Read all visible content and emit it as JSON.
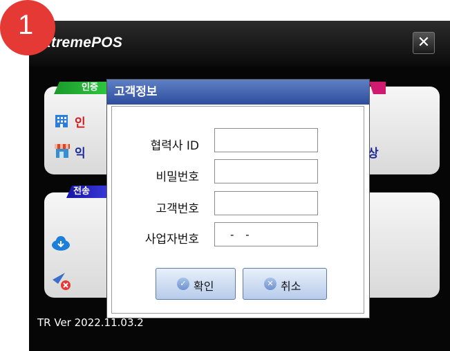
{
  "badge": "1",
  "app": {
    "logo_dots": "••",
    "logo_text": "xtremePOS",
    "close_icon": "✕",
    "version": "TR Ver 2022.11.03.2"
  },
  "panels": {
    "auth_tag": "인증",
    "transfer_tag": "전송",
    "row1_text": "인",
    "row2_text": "익",
    "row2_suffix": "상"
  },
  "dialog": {
    "title": "고객정보",
    "fields": [
      {
        "label": "협력사 ID",
        "value": ""
      },
      {
        "label": "비밀번호",
        "value": ""
      },
      {
        "label": "고객번호",
        "value": ""
      },
      {
        "label": "사업자번호",
        "value": "- -"
      }
    ],
    "ok_label": "확인",
    "cancel_label": "취소"
  },
  "colors": {
    "titlebar": "#2d4d9e",
    "auth_tag": "#1a9a2c",
    "transfer_tag": "#1414a8",
    "badge": "#e53935",
    "red_text": "#d01818",
    "blue_text": "#1a2a9a"
  }
}
